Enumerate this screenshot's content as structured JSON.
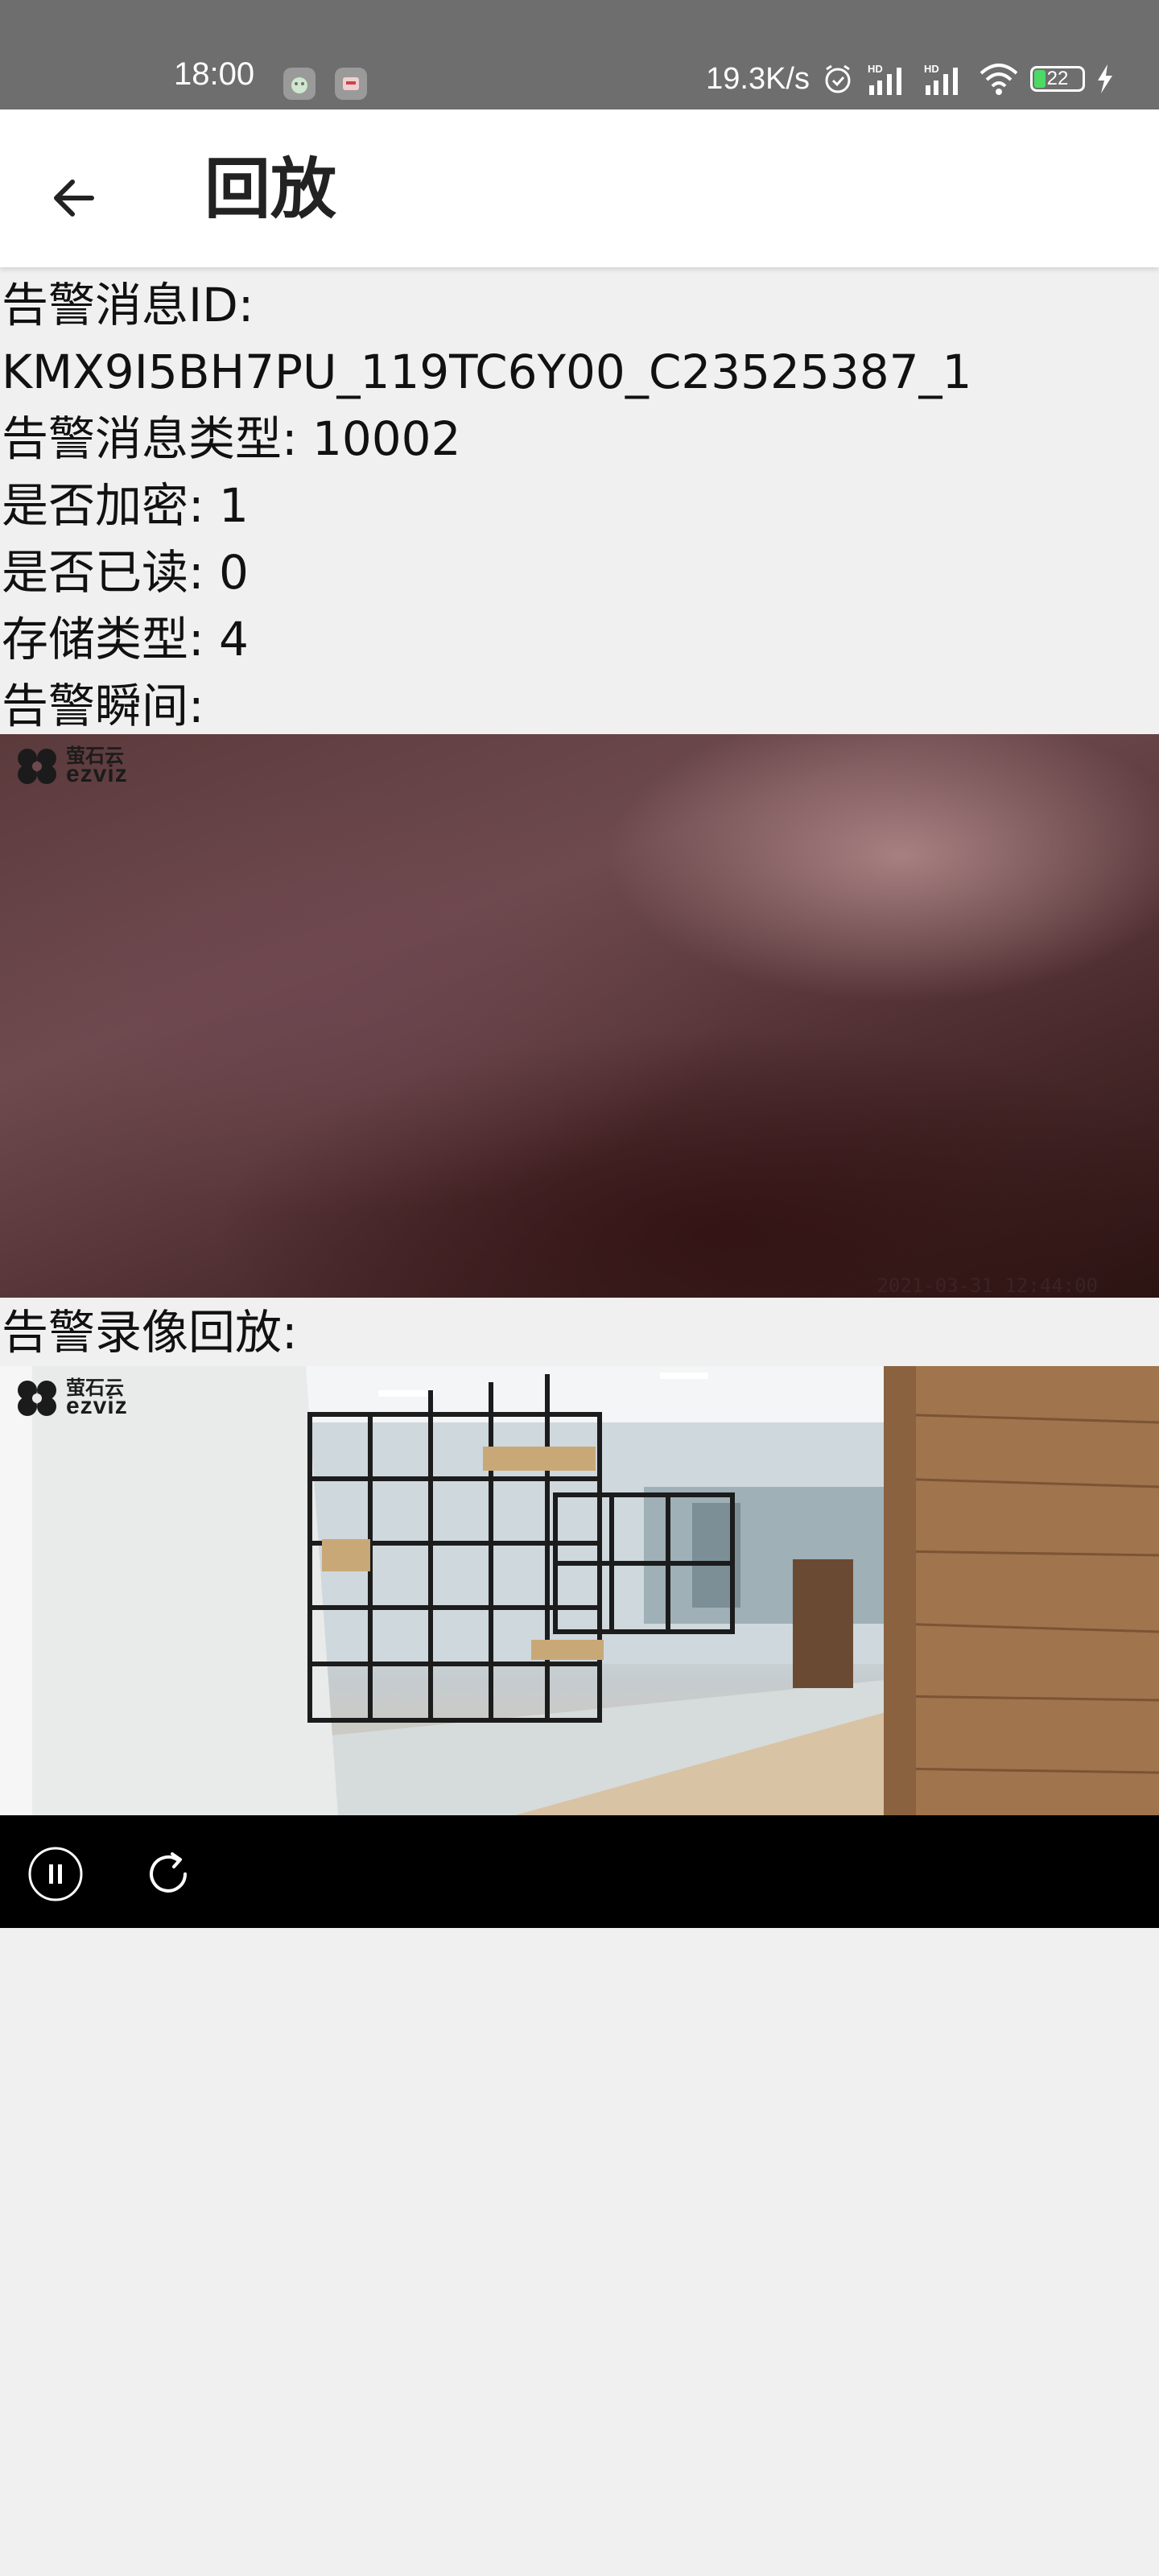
{
  "status_bar": {
    "time": "18:00",
    "network_speed": "19.3K/s",
    "battery_level": "22",
    "icons": [
      "app-icon-1",
      "app-icon-2",
      "alarm-icon",
      "hd-signal-icon",
      "hd-signal-icon",
      "wifi-icon",
      "battery-icon",
      "charging-icon"
    ]
  },
  "app_bar": {
    "back_icon": "arrow-left-icon",
    "title": "回放"
  },
  "info": {
    "msg_id_label": "告警消息ID:",
    "msg_id_value": "KMX9I5BH7PU_119TC6Y00_C23525387_1",
    "msg_type": "告警消息类型: 10002",
    "encrypted": "是否加密: 1",
    "read": "是否已读: 0",
    "storage_type": "存储类型: 4",
    "alarm_moment_label": "告警瞬间:"
  },
  "alarm_image": {
    "logo_top": "萤石云",
    "logo_bottom": "ezviz",
    "timestamp": "2021-03-31 12:44:00"
  },
  "video": {
    "label": "告警录像回放:",
    "logo_top": "萤石云",
    "logo_bottom": "ezviz",
    "controls": [
      "pause-icon",
      "refresh-icon"
    ]
  },
  "colors": {
    "status_bar_bg": "#6e6e6e",
    "app_bar_bg": "#ffffff",
    "page_bg": "#f0f0f0",
    "controls_bg": "#000000"
  }
}
